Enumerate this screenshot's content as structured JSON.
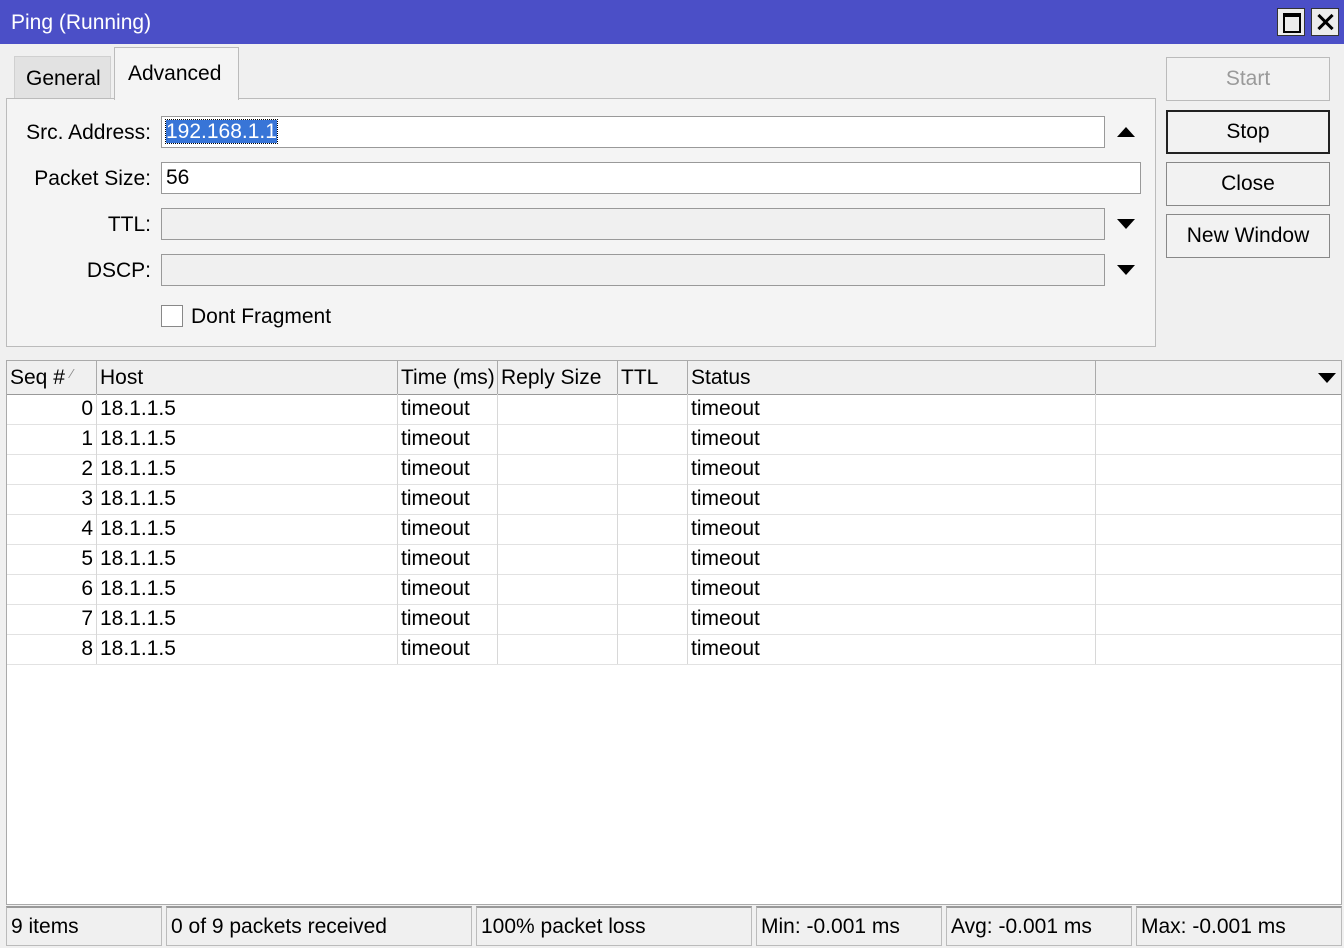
{
  "window": {
    "title": "Ping (Running)"
  },
  "tabs": [
    {
      "label": "General",
      "active": false
    },
    {
      "label": "Advanced",
      "active": true
    }
  ],
  "form": {
    "src_address": {
      "label": "Src. Address:",
      "value": "192.168.1.1"
    },
    "packet_size": {
      "label": "Packet Size:",
      "value": "56"
    },
    "ttl": {
      "label": "TTL:",
      "value": ""
    },
    "dscp": {
      "label": "DSCP:",
      "value": ""
    },
    "dont_fragment": {
      "label": "Dont Fragment",
      "checked": false
    }
  },
  "buttons": {
    "start": "Start",
    "stop": "Stop",
    "close": "Close",
    "new_window": "New Window"
  },
  "table": {
    "columns": [
      "Seq #",
      "Host",
      "Time (ms)",
      "Reply Size",
      "TTL",
      "Status"
    ],
    "sort_column": "Seq #",
    "rows": [
      [
        "0",
        "18.1.1.5",
        "timeout",
        "",
        "",
        "timeout"
      ],
      [
        "1",
        "18.1.1.5",
        "timeout",
        "",
        "",
        "timeout"
      ],
      [
        "2",
        "18.1.1.5",
        "timeout",
        "",
        "",
        "timeout"
      ],
      [
        "3",
        "18.1.1.5",
        "timeout",
        "",
        "",
        "timeout"
      ],
      [
        "4",
        "18.1.1.5",
        "timeout",
        "",
        "",
        "timeout"
      ],
      [
        "5",
        "18.1.1.5",
        "timeout",
        "",
        "",
        "timeout"
      ],
      [
        "6",
        "18.1.1.5",
        "timeout",
        "",
        "",
        "timeout"
      ],
      [
        "7",
        "18.1.1.5",
        "timeout",
        "",
        "",
        "timeout"
      ],
      [
        "8",
        "18.1.1.5",
        "timeout",
        "",
        "",
        "timeout"
      ]
    ]
  },
  "statusbar": {
    "items": "9 items",
    "received": "0 of 9 packets received",
    "loss": "100% packet loss",
    "min": "Min: -0.001 ms",
    "avg": "Avg: -0.001 ms",
    "max": "Max: -0.001 ms"
  },
  "colors": {
    "titlebar": "#4b4fc7",
    "selection": "#3875d7"
  }
}
